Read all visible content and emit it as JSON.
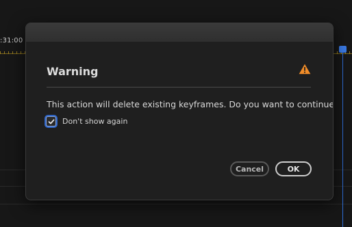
{
  "background": {
    "timecode": ":31:00"
  },
  "dialog": {
    "title": "Warning",
    "warning_icon": "warning-triangle-icon",
    "message": "This action will delete existing keyframes. Do you want to continue?",
    "checkbox": {
      "label": "Don't show again",
      "checked": true
    },
    "buttons": {
      "cancel_label": "Cancel",
      "ok_label": "OK"
    },
    "colors": {
      "warning": "#f08c28",
      "focus": "#2f66c9",
      "playhead": "#2f6fd8"
    }
  }
}
